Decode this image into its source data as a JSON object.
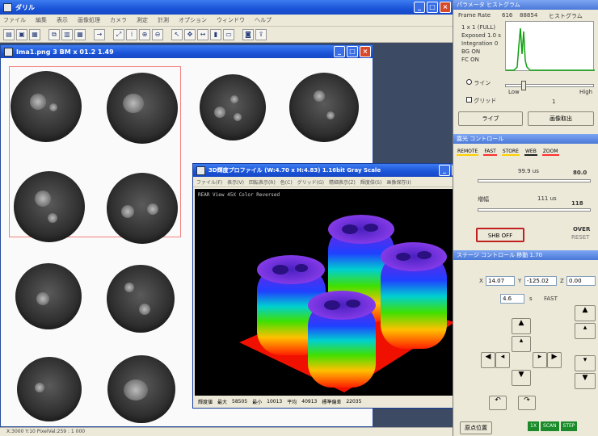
{
  "main_window": {
    "title": "ダリル",
    "menu": [
      "ファイル",
      "編集",
      "表示",
      "画像処理",
      "カメラ",
      "測定",
      "計測",
      "オプション",
      "ウィンドウ",
      "ヘルプ"
    ]
  },
  "image_window": {
    "title": "Ima1.png 3 BM x 01.2 1.49"
  },
  "profile_window": {
    "title": "3D輝度プロファイル (W:4.70 x H:4.83) 1.16bit Gray Scale",
    "menu": [
      "ファイル(F)",
      "表示(V)",
      "回転表示(R)",
      "色(C)",
      "グリッド(G)",
      "精細表示(Z)",
      "輝度倍(S)",
      "画像保存(I)"
    ],
    "view_info": "REAR View 45X Color Reversed",
    "status": [
      {
        "label": "輝度値",
        "value": ""
      },
      {
        "label": "最大",
        "value": "58505"
      },
      {
        "label": "最小",
        "value": "10013"
      },
      {
        "label": "平均",
        "value": "40913"
      },
      {
        "label": "標準偏差",
        "value": "22035"
      }
    ],
    "chart_data": {
      "type": "surface",
      "title": "",
      "xlabel": "",
      "ylabel": "",
      "series": [
        {
          "name": "",
          "values": [
            58505,
            56000,
            57200,
            55800
          ]
        }
      ],
      "min": 10013,
      "max": 58505,
      "colormap": [
        "#ff0000",
        "#ffff00",
        "#00ff00",
        "#00ffff",
        "#0000ff",
        "#8000ff"
      ]
    }
  },
  "histogram_panel": {
    "title": "パラメータ ヒストグラム",
    "frame_label": "Frame Rate",
    "frame_value": "616",
    "count_value": "88854",
    "histogram_label": "ヒストグラム",
    "params": [
      {
        "label": "1 x 1",
        "value": "(FULL)"
      },
      {
        "label": "Exposed",
        "value": "1.0 s"
      },
      {
        "label": "Integration",
        "value": "0"
      },
      {
        "label": "BG",
        "value": "ON"
      },
      {
        "label": "FC",
        "value": "ON"
      }
    ],
    "line_label": "ライン",
    "grid_label": "グリッド",
    "low_label": "Low",
    "high_label": "High",
    "slider_value": "1",
    "live_button": "ライブ",
    "capture_button": "画像取出"
  },
  "exposure_panel": {
    "title": "露光 コントロール",
    "filters": [
      {
        "label": "REMOTE",
        "color": "#ffd000"
      },
      {
        "label": "FAST",
        "color": "#ff3030"
      },
      {
        "label": "STORE",
        "color": "#ffd000"
      },
      {
        "label": "WEB",
        "color": "#202020"
      },
      {
        "label": "ZOOM",
        "color": "#ff3030"
      }
    ],
    "exposure_value": "99.9 us",
    "exposure_right": "80.0",
    "gain_label": "増幅",
    "gain_value": "111 us",
    "gain_right": "118",
    "shb_button": "SHB OFF",
    "over_label": "OVER",
    "over_sub": "RESET"
  },
  "stage_panel": {
    "title": "ステージ コントロール 移動 1.70",
    "x_label": "X",
    "x_value": "14.07",
    "y_label": "Y",
    "y_value": "-125.02",
    "z_label": "Z",
    "z_value": "0.00",
    "step_value": "4.6",
    "step_unit": "s",
    "fast_label": "FAST",
    "origin_button": "原点位置",
    "status_green": [
      "1X",
      "SCAN",
      "STEP"
    ]
  },
  "status_bar": {
    "text": "X:3000 Y:10 PixelVal:259 : 1 000"
  }
}
